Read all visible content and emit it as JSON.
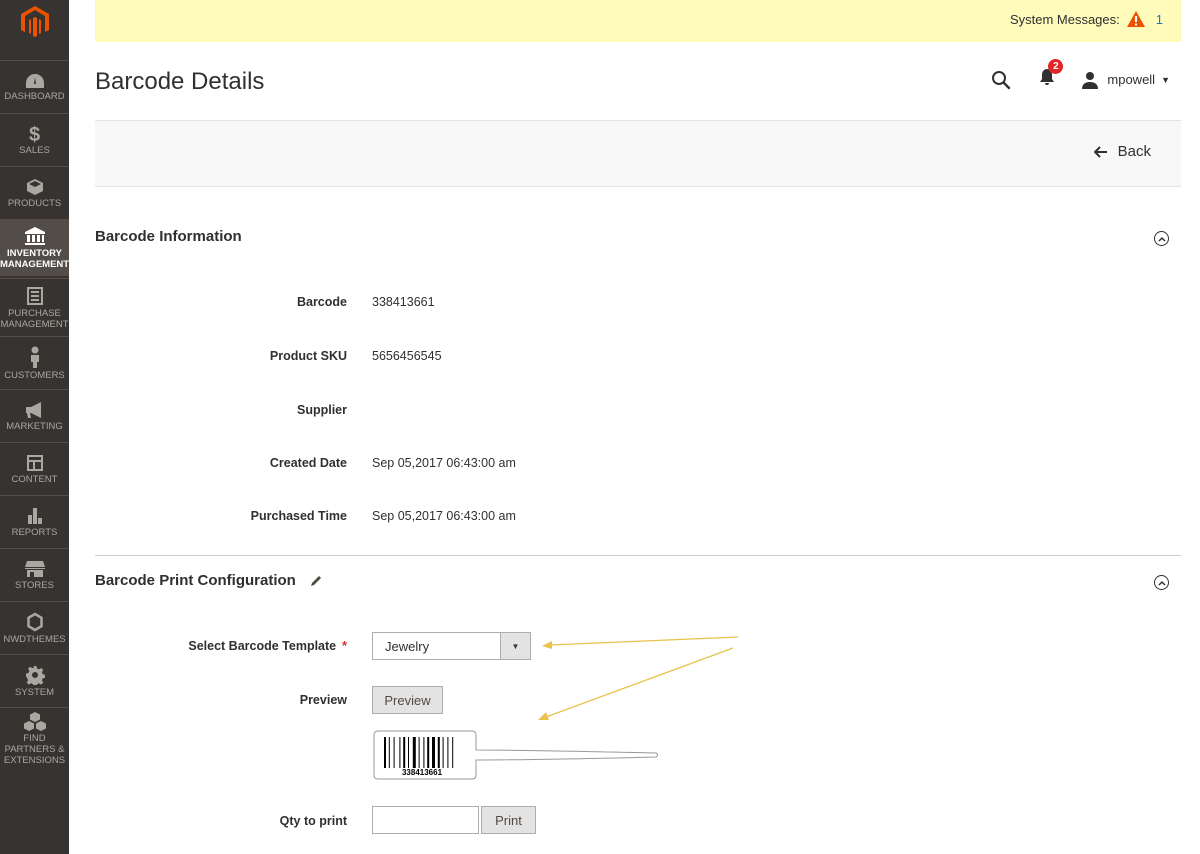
{
  "sidebar": {
    "items": [
      {
        "label": "DASHBOARD",
        "icon": "dashboard-icon"
      },
      {
        "label": "SALES",
        "icon": "dollar-icon"
      },
      {
        "label": "PRODUCTS",
        "icon": "box-icon"
      },
      {
        "label": "INVENTORY MANAGEMENT",
        "icon": "bank-icon",
        "active": true
      },
      {
        "label": "PURCHASE MANAGEMENT",
        "icon": "document-icon"
      },
      {
        "label": "CUSTOMERS",
        "icon": "person-icon"
      },
      {
        "label": "MARKETING",
        "icon": "megaphone-icon"
      },
      {
        "label": "CONTENT",
        "icon": "layout-icon"
      },
      {
        "label": "REPORTS",
        "icon": "bar-chart-icon"
      },
      {
        "label": "STORES",
        "icon": "store-icon"
      },
      {
        "label": "NWDTHEMES",
        "icon": "hexagon-icon"
      },
      {
        "label": "SYSTEM",
        "icon": "gear-icon"
      },
      {
        "label": "FIND PARTNERS & EXTENSIONS",
        "icon": "cubes-icon"
      }
    ]
  },
  "system_messages": {
    "label": "System Messages:",
    "count": "1"
  },
  "header": {
    "title": "Barcode Details",
    "notifications_count": "2",
    "username": "mpowell"
  },
  "actions": {
    "back_label": "Back"
  },
  "barcode_info": {
    "title": "Barcode Information",
    "fields": [
      {
        "label": "Barcode",
        "value": "338413661"
      },
      {
        "label": "Product SKU",
        "value": "5656456545"
      },
      {
        "label": "Supplier",
        "value": ""
      },
      {
        "label": "Created Date",
        "value": "Sep 05,2017 06:43:00 am"
      },
      {
        "label": "Purchased Time",
        "value": "Sep 05,2017 06:43:00 am"
      }
    ]
  },
  "print_config": {
    "title": "Barcode Print Configuration",
    "template_label": "Select Barcode Template",
    "template_value": "Jewelry",
    "preview_label": "Preview",
    "preview_button": "Preview",
    "preview_barcode_text": "338413661",
    "qty_label": "Qty to print",
    "print_button": "Print"
  },
  "colors": {
    "sidebar": "#373330",
    "accent": "#eb5202",
    "sysbar": "#fffbbb",
    "annotation": "#e8c24a"
  }
}
